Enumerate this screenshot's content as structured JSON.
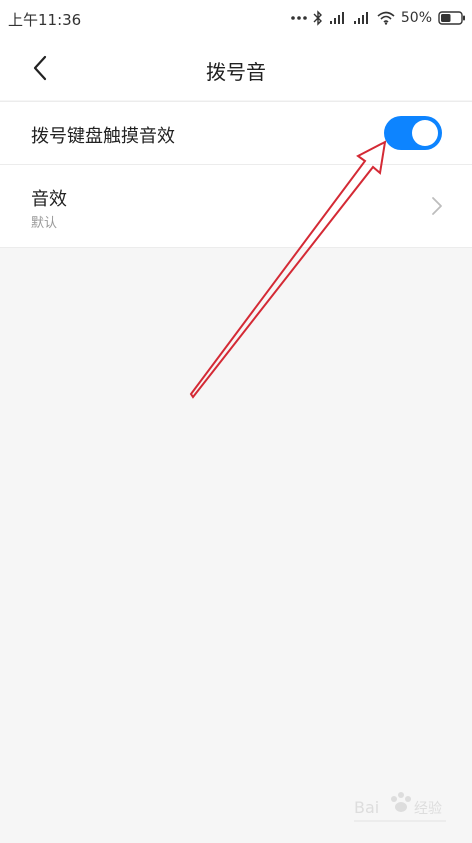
{
  "status_bar": {
    "time": "上午11:36",
    "battery_percent": "50%",
    "battery_level": 0.5,
    "icons": [
      "more-dots-icon",
      "bluetooth-icon",
      "signal-icon",
      "signal-icon",
      "wifi-icon",
      "battery-icon"
    ]
  },
  "header": {
    "title": "拨号音",
    "back_icon": "chevron-left-icon"
  },
  "settings": {
    "keypad_tone": {
      "label": "拨号键盘触摸音效",
      "enabled": true
    },
    "sound_effect": {
      "label": "音效",
      "value": "默认",
      "icon": "chevron-right-icon"
    }
  },
  "colors": {
    "accent": "#0d84ff",
    "annotation": "#d42a35",
    "background": "#f6f6f6"
  },
  "watermark": {
    "brand": "Baidu 经验"
  }
}
